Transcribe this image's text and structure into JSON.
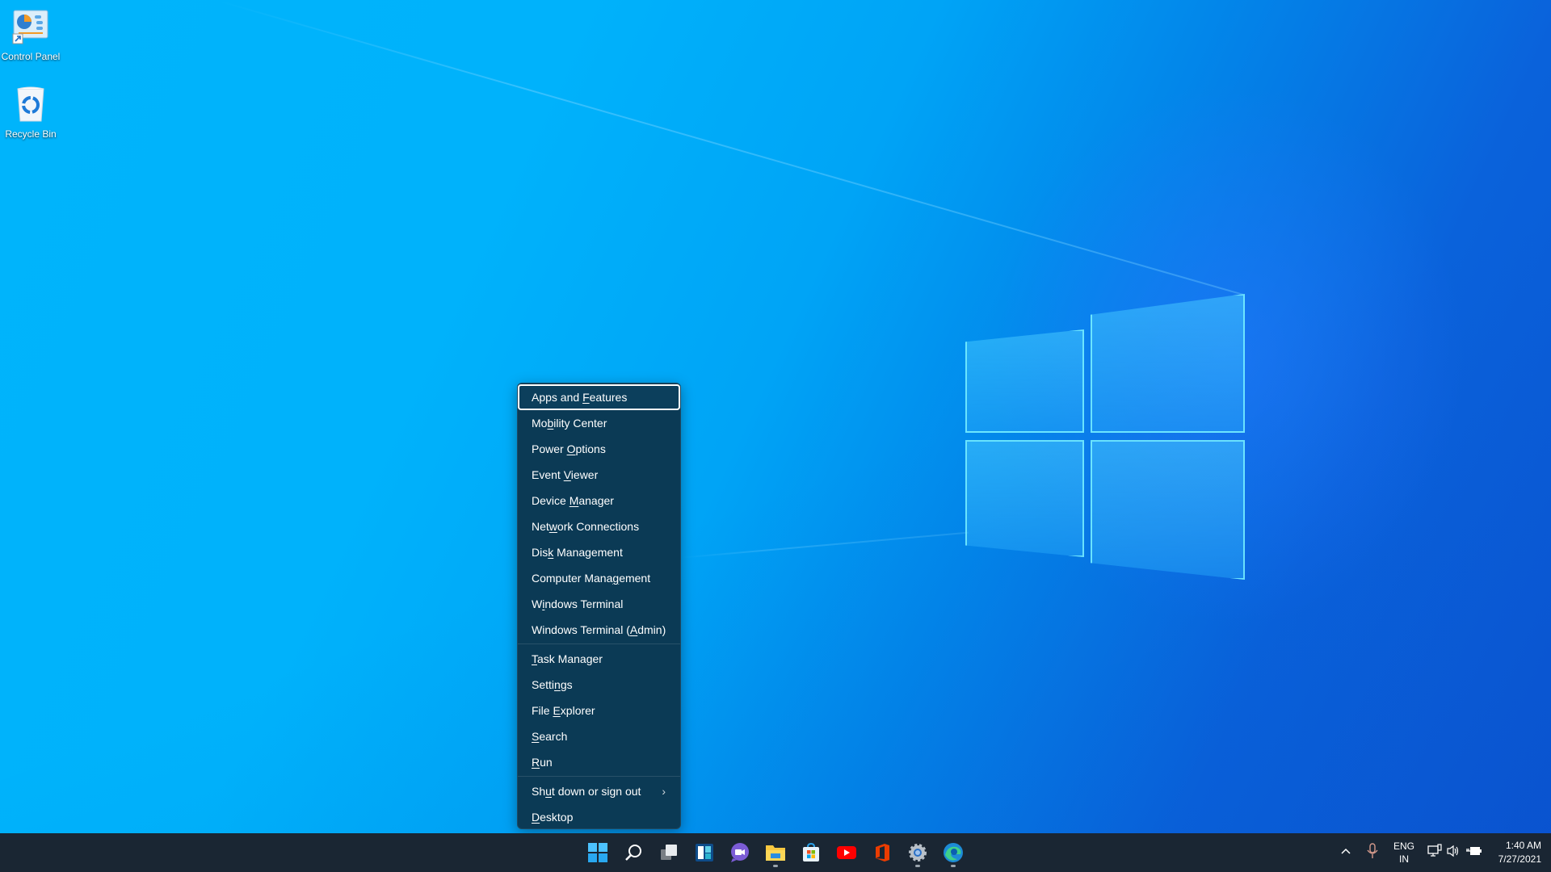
{
  "desktop": {
    "icons": [
      {
        "label": "Control Panel",
        "icon": "control-panel-icon"
      },
      {
        "label": "Recycle Bin",
        "icon": "recycle-bin-icon"
      }
    ]
  },
  "context_menu": {
    "focused_item": "Apps and Features",
    "groups": [
      [
        {
          "label": "Apps and Features",
          "access_key": "F"
        },
        {
          "label": "Mobility Center",
          "access_key": "b"
        },
        {
          "label": "Power Options",
          "access_key": "O"
        },
        {
          "label": "Event Viewer",
          "access_key": "V"
        },
        {
          "label": "Device Manager",
          "access_key": "M"
        },
        {
          "label": "Network Connections",
          "access_key": "w"
        },
        {
          "label": "Disk Management",
          "access_key": "k"
        },
        {
          "label": "Computer Management",
          "access_key": "g"
        },
        {
          "label": "Windows Terminal",
          "access_key": "i"
        },
        {
          "label": "Windows Terminal (Admin)",
          "access_key": "A"
        }
      ],
      [
        {
          "label": "Task Manager",
          "access_key": "T"
        },
        {
          "label": "Settings",
          "access_key": "n"
        },
        {
          "label": "File Explorer",
          "access_key": "E"
        },
        {
          "label": "Search",
          "access_key": "S"
        },
        {
          "label": "Run",
          "access_key": "R"
        }
      ],
      [
        {
          "label": "Shut down or sign out",
          "access_key": "u",
          "submenu": true,
          "submenu_icon": "chevron-right-icon"
        },
        {
          "label": "Desktop",
          "access_key": "D"
        }
      ]
    ]
  },
  "taskbar": {
    "apps": [
      {
        "name": "Start",
        "icon": "windows-start-icon",
        "running": false
      },
      {
        "name": "Search",
        "icon": "search-icon",
        "running": false
      },
      {
        "name": "Task View",
        "icon": "task-view-icon",
        "running": false
      },
      {
        "name": "Widgets",
        "icon": "widgets-icon",
        "running": false
      },
      {
        "name": "Chat",
        "icon": "teams-chat-icon",
        "running": false
      },
      {
        "name": "File Explorer",
        "icon": "folder-icon",
        "running": true
      },
      {
        "name": "Microsoft Store",
        "icon": "store-icon",
        "running": false
      },
      {
        "name": "YouTube",
        "icon": "youtube-icon",
        "running": false
      },
      {
        "name": "Office",
        "icon": "office-icon",
        "running": false
      },
      {
        "name": "Settings",
        "icon": "gear-icon",
        "running": true
      },
      {
        "name": "Microsoft Edge",
        "icon": "edge-icon",
        "running": true
      }
    ],
    "tray": {
      "overflow_icon": "chevron-up-icon",
      "mic_icon": "microphone-icon",
      "language_line1": "ENG",
      "language_line2": "IN",
      "network_icon": "network-icon",
      "volume_icon": "volume-icon",
      "battery_icon": "battery-charging-icon",
      "time": "1:40 AM",
      "date": "7/27/2021"
    }
  },
  "colors": {
    "menu_bg": "#0b3a55",
    "taskbar_bg": "#1a2633",
    "wallpaper_light": "#00b4fb",
    "wallpaper_dark": "#0b55d2"
  }
}
